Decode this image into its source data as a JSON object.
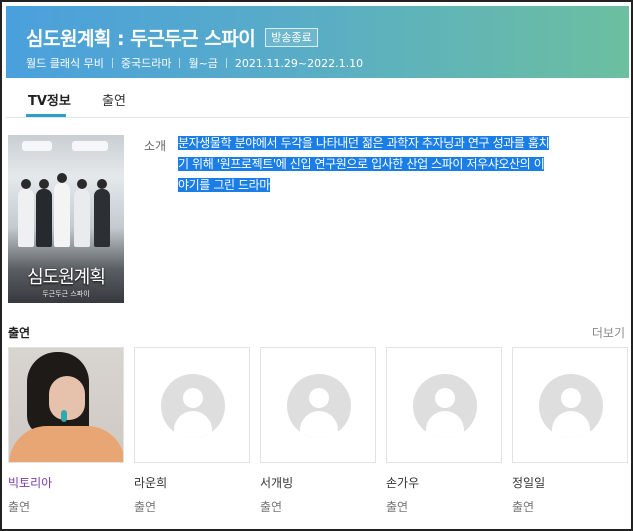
{
  "header": {
    "title": "심도원계획 : 두근두근 스파이",
    "status_badge": "방송종료",
    "channel": "월드 클래식 무비",
    "genre": "중국드라마",
    "schedule": "월~금",
    "period": "2021.11.29~2022.1.10"
  },
  "tabs": [
    {
      "label": "TV정보",
      "active": true
    },
    {
      "label": "출연",
      "active": false
    }
  ],
  "poster": {
    "title": "심도원계획",
    "subtitle": "두근두근 스파이"
  },
  "intro": {
    "label": "소개",
    "lines": [
      "분자생물학 분야에서 두각을 나타내던 젊은 과학자 추자닝과 연구 성과를 훔치",
      "기 위해 '원프로젝트'에 신입 연구원으로 입사한 산업 스파이 저우샤오산의 이",
      "야기를 그린 드라마"
    ],
    "highlight_color": "#1a7ee6"
  },
  "cast": {
    "heading": "출연",
    "more_label": "더보기",
    "members": [
      {
        "name": "빅토리아",
        "role": "출연",
        "has_photo": true
      },
      {
        "name": "라운희",
        "role": "출연",
        "has_photo": false
      },
      {
        "name": "서개빙",
        "role": "출연",
        "has_photo": false
      },
      {
        "name": "손가우",
        "role": "출연",
        "has_photo": false
      },
      {
        "name": "정일일",
        "role": "출연",
        "has_photo": false
      }
    ]
  },
  "colors": {
    "header_gradient_start": "#4aa0dc",
    "header_gradient_end": "#6cbfa0",
    "tab_accent": "#2aa0c8",
    "active_cast_name": "#7b3aa8"
  }
}
